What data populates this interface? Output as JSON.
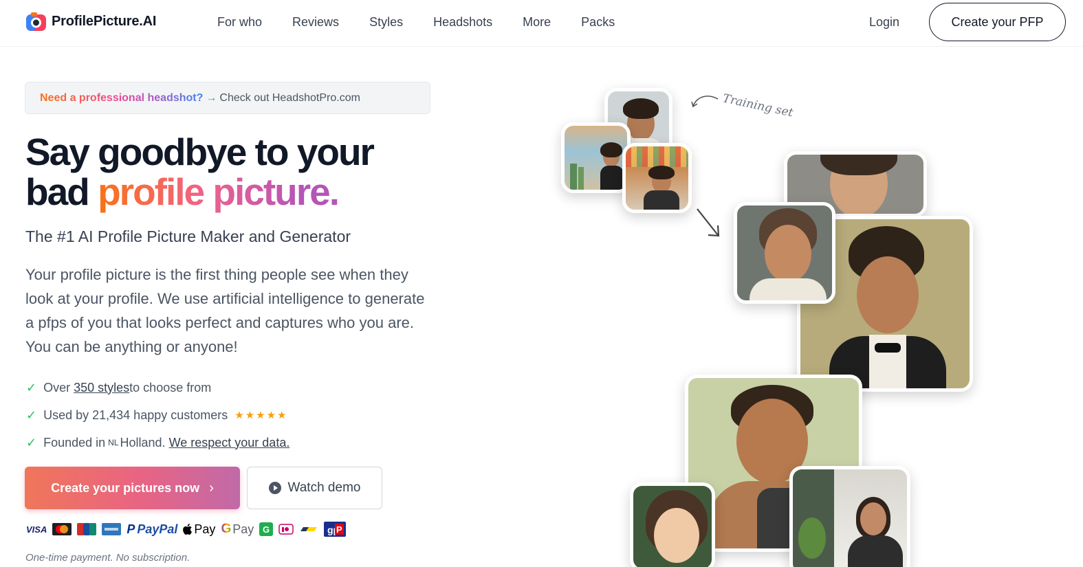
{
  "brand": {
    "name": "ProfilePicture.AI"
  },
  "nav": {
    "links": [
      "For who",
      "Reviews",
      "Styles",
      "Headshots",
      "More",
      "Packs"
    ],
    "login": "Login",
    "cta": "Create your PFP"
  },
  "notice": {
    "prompt": "Need a professional headshot?",
    "arrow": "→",
    "link": "Check out HeadshotPro.com"
  },
  "hero": {
    "line1": "Say goodbye to your",
    "line2_plain": "bad ",
    "line2_grad": "profile picture."
  },
  "subtitle": "The #1 AI Profile Picture Maker and Generator",
  "description": "Your profile picture is the first thing people see when they look at your profile. We use artificial intelligence to generate a pfps of you that looks perfect and captures who you are. You can be anything or anyone!",
  "features": {
    "f1_prefix": "Over ",
    "f1_link": "350 styles ",
    "f1_suffix": "to choose from",
    "f2": "Used by 21,434 happy customers",
    "f2_stars": "★★★★★",
    "f3_prefix": "Founded in",
    "f3_flag": "NL",
    "f3_country": "Holland.",
    "f3_link": "We respect your data."
  },
  "buttons": {
    "primary": "Create your pictures now",
    "primary_chevron": "›",
    "demo": "Watch demo"
  },
  "payments": {
    "visa": "VISA",
    "paypal": "PayPal",
    "applepay": "Pay",
    "gpay": "Pay",
    "methods": [
      "visa",
      "mastercard",
      "unionpay",
      "amex",
      "paypal",
      "apple-pay",
      "google-pay",
      "giropay",
      "ideal",
      "bancontact",
      "generic"
    ]
  },
  "footnote": "One-time payment. No subscription.",
  "collage": {
    "training_label": "Training set",
    "colors": {
      "bg_peach": "#f7d9a8",
      "bg_olive": "#b8ad7c",
      "bg_mint": "#9fd8c5",
      "bg_grey": "#8b8b86",
      "bg_green": "#c9d4a8",
      "bg_pink": "#e8a28f",
      "skin": "#c98a5e",
      "hair": "#3a2a1e"
    }
  }
}
